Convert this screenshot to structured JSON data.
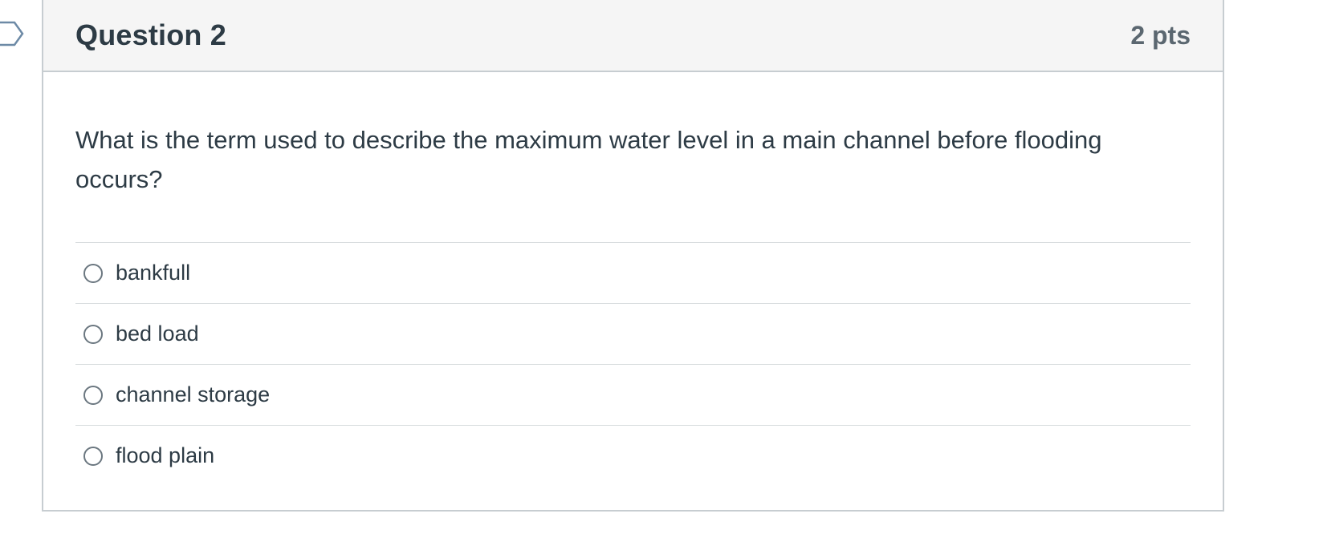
{
  "question": {
    "title": "Question 2",
    "points": "2 pts",
    "text": "What is the term used to describe the maximum water level in a main channel before flooding occurs?",
    "answers": [
      {
        "label": "bankfull",
        "selected": false
      },
      {
        "label": "bed load",
        "selected": false
      },
      {
        "label": "channel storage",
        "selected": false
      },
      {
        "label": "flood plain",
        "selected": false
      }
    ]
  },
  "icons": {
    "flag": "flag-question-icon"
  },
  "colors": {
    "header_bg": "#f5f5f5",
    "border": "#c7cdd1",
    "text": "#2d3b45",
    "points": "#5b6770",
    "flag_stroke": "#6d8aa6"
  }
}
